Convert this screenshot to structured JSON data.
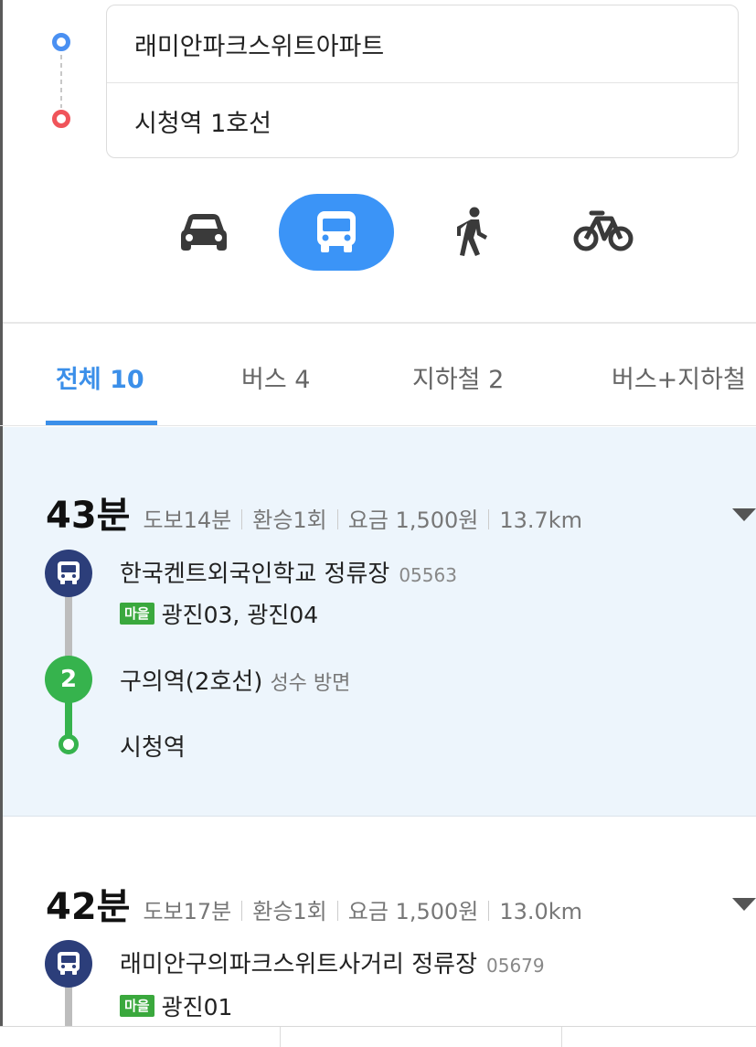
{
  "search": {
    "origin": "래미안파크스위트아파트",
    "destination": "시청역 1호선"
  },
  "modes": [
    {
      "name": "car",
      "icon": "car-icon",
      "active": false
    },
    {
      "name": "bus",
      "icon": "bus-icon",
      "active": true
    },
    {
      "name": "walk",
      "icon": "walk-icon",
      "active": false
    },
    {
      "name": "bike",
      "icon": "bicycle-icon",
      "active": false
    }
  ],
  "tabs": [
    {
      "label": "전체 10",
      "active": true
    },
    {
      "label": "버스 4",
      "active": false
    },
    {
      "label": "지하철 2",
      "active": false
    },
    {
      "label": "버스+지하철",
      "active": false
    }
  ],
  "routes": [
    {
      "duration": "43분",
      "walk": "도보14분",
      "transfer": "환승1회",
      "fare": "요금 1,500원",
      "distance": "13.7km",
      "steps": [
        {
          "type": "bus",
          "stop": "한국켄트외국인학교 정류장",
          "stop_id": "05563",
          "badge": "마을",
          "lines": "광진03, 광진04"
        },
        {
          "type": "subway",
          "line_no": "2",
          "stop": "구의역(2호선)",
          "direction": "성수 방면"
        },
        {
          "type": "end",
          "stop": "시청역"
        }
      ]
    },
    {
      "duration": "42분",
      "walk": "도보17분",
      "transfer": "환승1회",
      "fare": "요금 1,500원",
      "distance": "13.0km",
      "steps": [
        {
          "type": "bus",
          "stop": "래미안구의파크스위트사거리 정류장",
          "stop_id": "05679",
          "badge": "마을",
          "lines": "광진01"
        }
      ]
    }
  ],
  "colors": {
    "accent": "#3b94f7",
    "tab_active": "#3b8fe9",
    "origin_pin": "#4a90f2",
    "destination_pin": "#f0545a",
    "bus_circle": "#2c3e7a",
    "line2": "#36b34d",
    "village_badge": "#3aa83d",
    "highlight_bg": "#edf5fc"
  }
}
